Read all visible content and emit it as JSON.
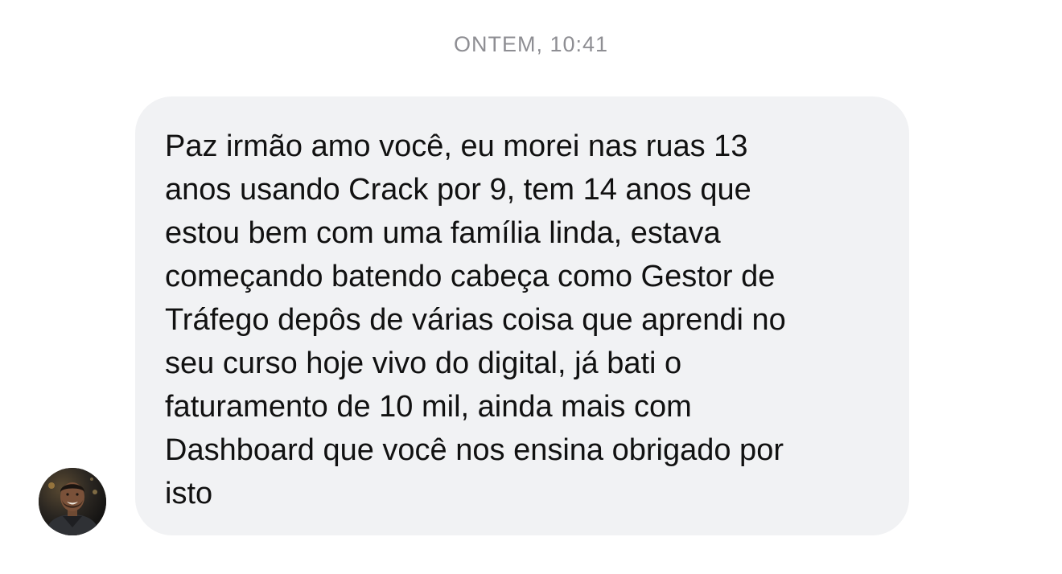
{
  "conversation": {
    "timestamp": "ONTEM, 10:41",
    "message": {
      "lines": [
        "Paz irmão amo você, eu morei nas ruas 13",
        "anos usando Crack por 9, tem 14 anos que",
        "estou bem com uma família linda, estava",
        "começando batendo cabeça como Gestor de",
        "Tráfego depôs de várias coisa que aprendi no",
        "seu curso hoje vivo do digital, já bati o",
        "faturamento de 10 mil, ainda mais com",
        "Dashboard que você nos ensina obrigado por",
        "isto"
      ]
    },
    "sender": {
      "avatar_icon": "user-avatar-photo"
    }
  },
  "colors": {
    "bubble_background": "#f1f2f4",
    "timestamp": "#8e8e93",
    "text": "#111111"
  }
}
